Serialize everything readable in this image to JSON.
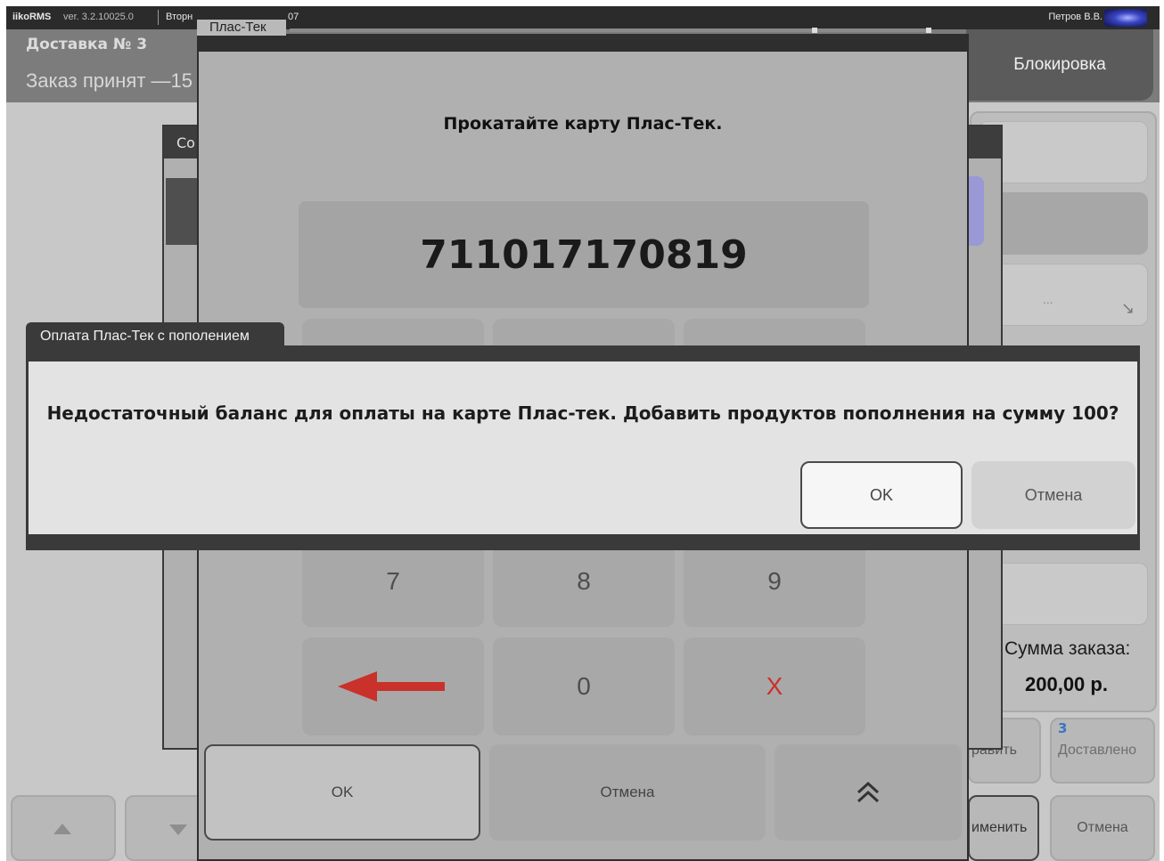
{
  "system_bar": {
    "app_name": "iikoRMS",
    "version": "ver. 3.2.10025.0",
    "day": "Вторн",
    "time": "07",
    "user": "Петров В.В."
  },
  "order": {
    "title": "Доставка № 3",
    "status": "Заказ принят —15",
    "lock_label": "Блокировка",
    "sum_label": "Сумма заказа:",
    "sum_value": "200,00 р.",
    "right_dots": "...",
    "right_arrow": "↘"
  },
  "bottom_bar": {
    "send_label": "равить",
    "delivered_count": "3",
    "delivered_label": "Доставлено",
    "apply_label": "именить",
    "cancel_label": "Отмена"
  },
  "under_dialog": {
    "title": "Со"
  },
  "plastek_dialog": {
    "tab_title": "Плас-Тек",
    "prompt": "Прокатайте карту Плас-Тек.",
    "card_number": "711017170819",
    "keys": [
      "7",
      "8",
      "9",
      "",
      "0",
      "X"
    ],
    "ok_label": "OK",
    "cancel_label": "Отмена",
    "up_icon": "double-chevron-up"
  },
  "confirm_dialog": {
    "title": "Оплата Плас-Тек с пополением",
    "message": "Недостаточный баланс для оплаты на карте Плас-тек. Добавить продуктов пополнения на сумму 100?",
    "ok_label": "OK",
    "cancel_label": "Отмена"
  },
  "colors": {
    "header_bg": "#7c7c7c",
    "dialog_border": "#3a3a3a",
    "clear_key": "#c9312b",
    "backspace_arrow": "#c9312b",
    "delivered_count": "#3b73c8"
  }
}
